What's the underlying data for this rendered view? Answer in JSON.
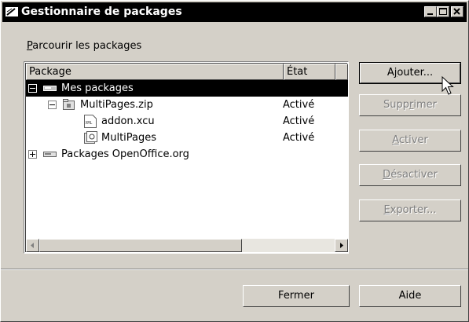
{
  "window": {
    "title": "Gestionnaire de packages"
  },
  "browse_label": {
    "accel": "P",
    "rest": "arcourir les packages"
  },
  "columns": {
    "package": "Package",
    "state": "État"
  },
  "tree": [
    {
      "name": "Mes packages",
      "state": "",
      "icon": "drive-icon",
      "selected": true
    },
    {
      "name": "MultiPages.zip",
      "state": "Activé",
      "icon": "zip-archive-icon",
      "selected": false
    },
    {
      "name": "addon.xcu",
      "state": "Activé",
      "icon": "xml-file-icon",
      "selected": false
    },
    {
      "name": "MultiPages",
      "state": "Activé",
      "icon": "basic-library-icon",
      "selected": false
    },
    {
      "name": "Packages OpenOffice.org",
      "state": "",
      "icon": "drive-icon",
      "selected": false
    }
  ],
  "buttons": {
    "add": {
      "pre": "A",
      "accel": "j",
      "post": "outer..."
    },
    "remove": {
      "pre": "Supp",
      "accel": "r",
      "post": "imer"
    },
    "enable": {
      "pre": "",
      "accel": "A",
      "post": "ctiver"
    },
    "disable": {
      "pre": "",
      "accel": "D",
      "post": "ésactiver"
    },
    "export": {
      "pre": "",
      "accel": "E",
      "post": "xporter..."
    },
    "close": "Fermer",
    "help": "Aide"
  }
}
